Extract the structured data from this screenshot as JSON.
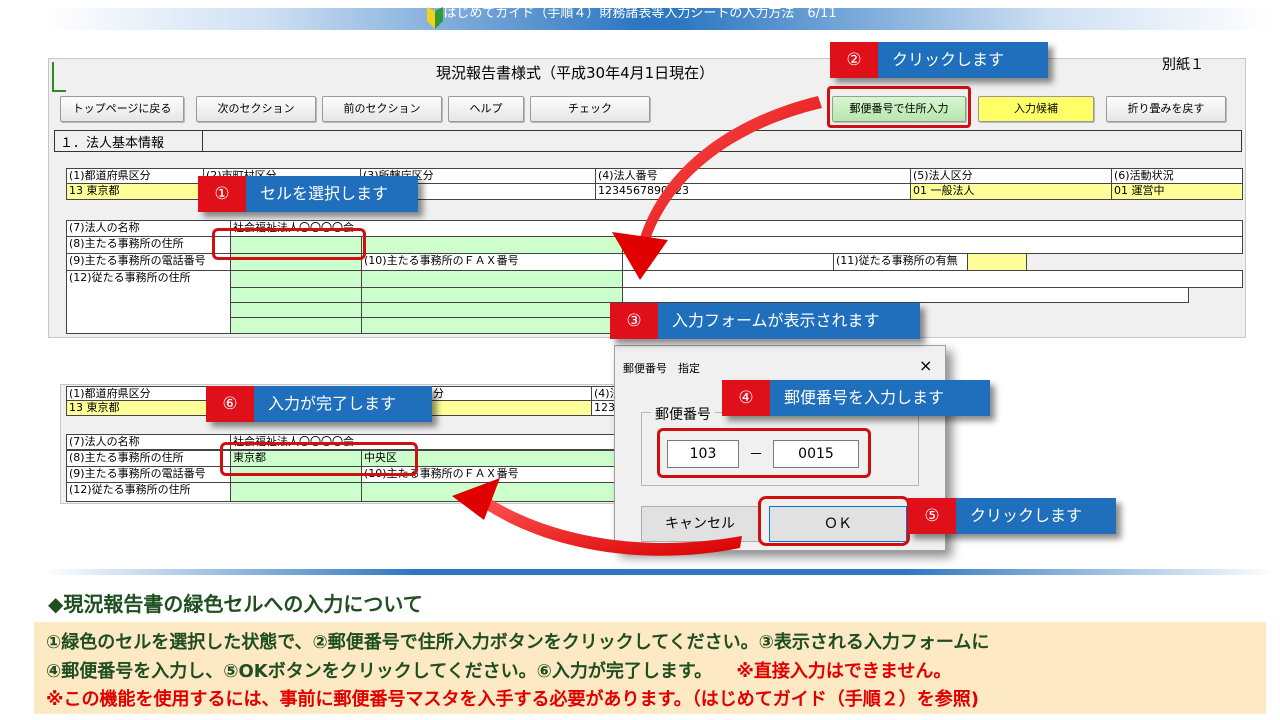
{
  "header": {
    "title": "はじめてガイド（手順４）財務諸表等入力シートの入力方法　6/11"
  },
  "sheet": {
    "title": "現況報告書様式（平成30年4月1日現在）",
    "annex": "別紙１",
    "buttons": [
      "トップページに戻る",
      "次のセクション",
      "前のセクション",
      "ヘルプ",
      "チェック"
    ],
    "zip_button": "郵便番号で住所入力",
    "candidate_button": "入力候補",
    "collapse_button": "折り畳みを戻す",
    "section_title": "１．法人基本情報",
    "headers": {
      "h1": "(1)都道府県区分",
      "h2": "(2)市町村区分",
      "h3": "(3)所轄庁区分",
      "h4": "(4)法人番号",
      "h5": "(5)法人区分",
      "h6": "(6)活動状況"
    },
    "values": {
      "pref": "13 東京都",
      "corp_no": "1234567890123",
      "corp_type": "01 一般法人",
      "status": "01 運営中"
    },
    "rows": {
      "r7": "(7)法人の名称",
      "r7_val": "社会福祉法人〇〇〇〇会",
      "r8": "(8)主たる事務所の住所",
      "r9": "(9)主たる事務所の電話番号",
      "r10": "(10)主たる事務所のＦＡＸ番号",
      "r11": "(11)従たる事務所の有無",
      "r12": "(12)従たる事務所の住所"
    }
  },
  "result": {
    "h1": "(1)都道府県区分",
    "h2": "分",
    "h4": "(4)法",
    "pref": "13 東京都",
    "corp_no_part": "123",
    "r7": "(7)法人の名称",
    "r7_val": "社会福祉法人〇〇〇〇会",
    "r8": "(8)主たる事務所の住所",
    "addr1": "東京都",
    "addr2": "中央区",
    "r9": "(9)主たる事務所の電話番号",
    "r10": "(10)主たる事務所のＦＡＸ番号",
    "r12": "(12)従たる事務所の住所"
  },
  "dialog": {
    "title": "郵便番号　指定",
    "close": "×",
    "group_label": "郵便番号",
    "zip1": "103",
    "dash": "－",
    "zip2": "0015",
    "cancel": "キャンセル",
    "ok": "ＯＫ"
  },
  "callouts": [
    {
      "num": "①",
      "text": "セルを選択します"
    },
    {
      "num": "②",
      "text": "クリックします"
    },
    {
      "num": "③",
      "text": "入力フォームが表示されます"
    },
    {
      "num": "④",
      "text": "郵便番号を入力します"
    },
    {
      "num": "⑤",
      "text": "クリックします"
    },
    {
      "num": "⑥",
      "text": "入力が完了します"
    }
  ],
  "bottom": {
    "title": "◆現況報告書の緑色セルへの入力について",
    "line1": "①緑色のセルを選択した状態で、②郵便番号で住所入力ボタンをクリックしてください。③表示される入力フォームに",
    "line2a": "④郵便番号を入力し、⑤OKボタンをクリックしてください。⑥入力が完了します。",
    "line2b": "※直接入力はできません。",
    "line3": "※この機能を使用するには、事前に郵便番号マスタを入手する必要があります。（はじめてガイド（手順２）を参照)"
  },
  "colors": {
    "accent_blue": "#1f6fbd",
    "accent_red": "#e0101a",
    "cell_green": "#ccffcc",
    "cell_yellow": "#ffff99"
  }
}
